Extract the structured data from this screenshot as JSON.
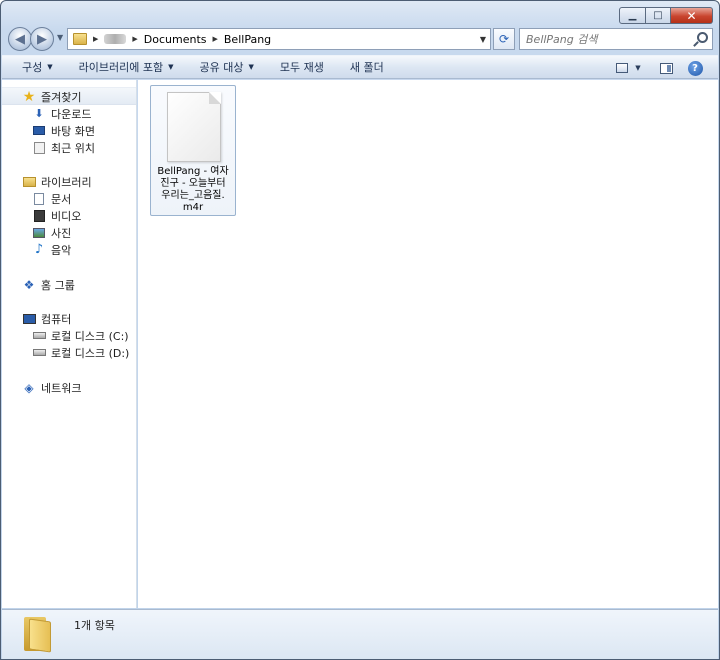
{
  "window": {
    "minimize_label": "▁",
    "maximize_label": "□",
    "close_label": "✕"
  },
  "nav": {
    "back_label": "◀",
    "forward_label": "▶",
    "breadcrumbs": [
      "Documents",
      "BellPang"
    ],
    "search_placeholder": "BellPang 검색"
  },
  "toolbar": {
    "organize": "구성",
    "include_library": "라이브러리에 포함",
    "share_with": "공유 대상",
    "play_all": "모두 재생",
    "new_folder": "새 폴더",
    "help": "?"
  },
  "sidebar": {
    "favorites": {
      "label": "즐겨찾기",
      "items": [
        {
          "label": "다운로드",
          "icon": "downloads-icon"
        },
        {
          "label": "바탕 화면",
          "icon": "desktop-icon"
        },
        {
          "label": "최근 위치",
          "icon": "recent-places-icon"
        }
      ]
    },
    "libraries": {
      "label": "라이브러리",
      "items": [
        {
          "label": "문서",
          "icon": "documents-icon"
        },
        {
          "label": "비디오",
          "icon": "videos-icon"
        },
        {
          "label": "사진",
          "icon": "pictures-icon"
        },
        {
          "label": "음악",
          "icon": "music-icon"
        }
      ]
    },
    "homegroup": {
      "label": "홈 그룹"
    },
    "computer": {
      "label": "컴퓨터",
      "items": [
        {
          "label": "로컬 디스크 (C:)",
          "icon": "drive-c-icon"
        },
        {
          "label": "로컬 디스크 (D:)",
          "icon": "drive-d-icon"
        }
      ]
    },
    "network": {
      "label": "네트워크"
    }
  },
  "files": [
    {
      "name_lines": [
        "BellPang - 여자",
        "진구 - 오늘부터",
        "우리는_고음질.",
        "m4r"
      ]
    }
  ],
  "status": {
    "item_count": "1개 항목"
  },
  "colors": {
    "window_frame": "#c0d3ea",
    "toolbar_text": "#1e3252",
    "close_button": "#c9452f"
  }
}
